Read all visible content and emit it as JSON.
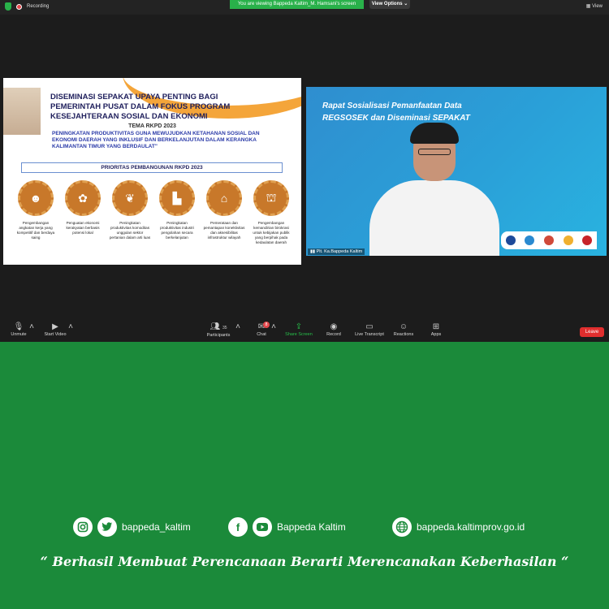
{
  "topbar": {
    "recording_label": "Recording",
    "banner": "You are viewing Bappeda Kaltim_M. Hamsani's screen",
    "view_options": "View Options",
    "view": "View"
  },
  "slide": {
    "title": "DISEMINASI SEPAKAT UPAYA PENTING BAGI PEMERINTAH PUSAT DALAM FOKUS PROGRAM KESEJAHTERAAN SOSIAL DAN EKONOMI",
    "tema": "TEMA RKPD 2023",
    "subtitle": "PENINGKATAN PRODUKTIVITAS GUNA MEWUJUDKAN KETAHANAN SOSIAL DAN EKONOMI DAERAH YANG INKLUSIF DAN BERKELANJUTAN DALAM KERANGKA KALIMANTAN TIMUR YANG BERDAULAT\"",
    "priority_header": "PRIORITAS PEMBANGUNAN RKPD 2023",
    "priorities": [
      "Pengembangan angkatan kerja yang kompetitif dan berdaya saing",
      "Penguatan ekonomi kerakyatan berbasis potensi lokal",
      "Peningkatan produktivitas komoditas unggulan sektor pertanian dalam arti luas",
      "Peningkatan produktivitas industri pengolahan secara berkelanjutan",
      "Pemerataan dan pemantapan konektivitas dan aksesibilitas infrastruktur wilayah",
      "Pengembangan kemandirian birokrasi untuk kebijakan publik yang berpihak pada kedaulatan daerah"
    ]
  },
  "speaker": {
    "title_line1": "Rapat Sosialisasi Pemanfaatan Data",
    "title_line2": "REGSOSEK dan Diseminasi SEPAKAT",
    "name_tag": "Plt. Ka.Bappeda Kaltim"
  },
  "toolbar": {
    "unmute": "Unmute",
    "start_video": "Start Video",
    "participants": "Participants",
    "participants_count": "35",
    "chat": "Chat",
    "chat_badge": "8",
    "share_screen": "Share Screen",
    "record": "Record",
    "live_transcript": "Live Transcript",
    "reactions": "Reactions",
    "apps": "Apps",
    "leave": "Leave"
  },
  "footer": {
    "handle_1": "bappeda_kaltim",
    "handle_2": "Bappeda Kaltim",
    "website": "bappeda.kaltimprov.go.id",
    "quote": "“ Berhasil  Membuat Perencanaan Berarti Merencanakan Keberhasilan “"
  },
  "colors": {
    "background_green": "#1b8a3a",
    "leave_red": "#e02e2e",
    "share_green": "#27c04a",
    "slide_orange": "#f4a53a"
  }
}
